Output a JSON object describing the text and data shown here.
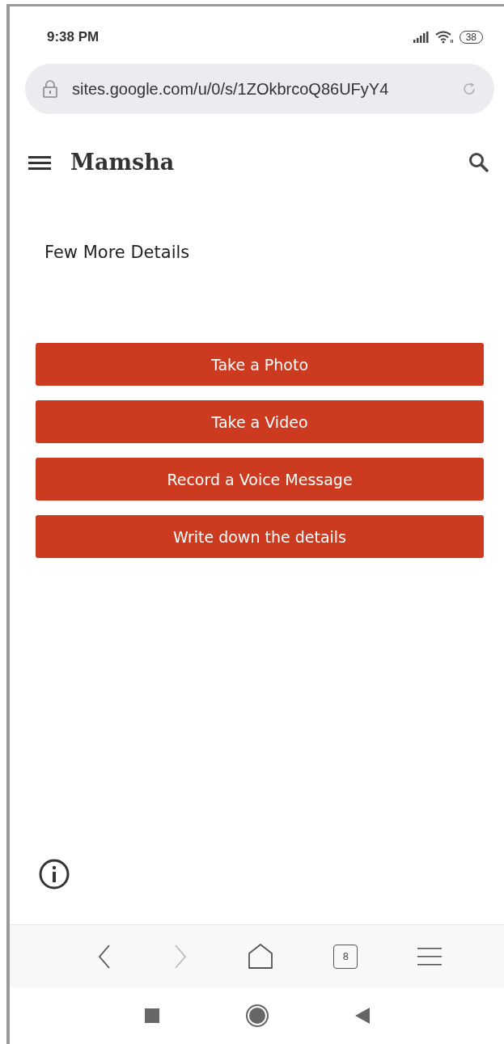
{
  "status_bar": {
    "time": "9:38 PM",
    "battery": "38"
  },
  "address_bar": {
    "url": "sites.google.com/u/0/s/1ZOkbrcoQ86UFyY4"
  },
  "site_header": {
    "title": "Mamsha"
  },
  "page": {
    "heading": "Few More Details",
    "buttons": [
      "Take a Photo",
      "Take a Video",
      "Record a Voice Message",
      "Write down the details"
    ]
  },
  "browser_toolbar": {
    "back_disabled": false,
    "forward_disabled": true,
    "tab_count": "8"
  }
}
